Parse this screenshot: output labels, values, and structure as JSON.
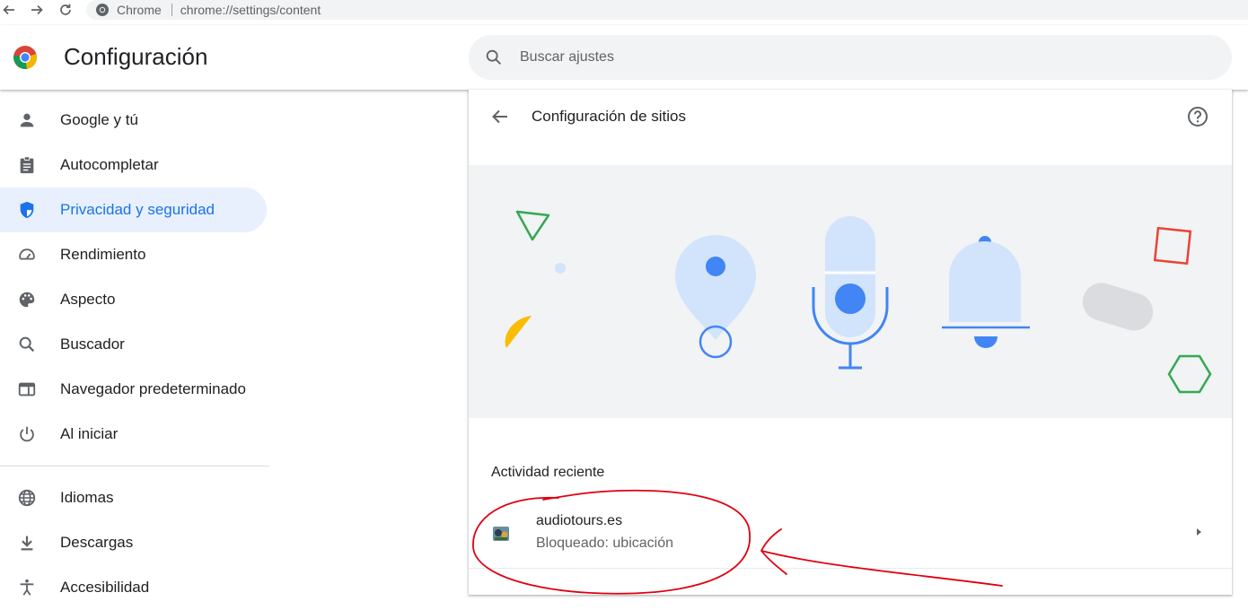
{
  "browser": {
    "back_icon": "arrow-back-icon",
    "forward_icon": "arrow-forward-icon",
    "reload_icon": "reload-icon",
    "site_label": "Chrome",
    "url": "chrome://settings/content"
  },
  "header": {
    "title": "Configuración",
    "search_placeholder": "Buscar ajustes"
  },
  "sidebar": {
    "items": [
      {
        "label": "Google y tú",
        "icon": "person-icon"
      },
      {
        "label": "Autocompletar",
        "icon": "clipboard-icon"
      },
      {
        "label": "Privacidad y seguridad",
        "icon": "shield-icon",
        "active": true
      },
      {
        "label": "Rendimiento",
        "icon": "speedometer-icon"
      },
      {
        "label": "Aspecto",
        "icon": "palette-icon"
      },
      {
        "label": "Buscador",
        "icon": "search-icon"
      },
      {
        "label": "Navegador predeterminado",
        "icon": "browser-window-icon"
      },
      {
        "label": "Al iniciar",
        "icon": "power-icon"
      }
    ],
    "items2": [
      {
        "label": "Idiomas",
        "icon": "globe-icon"
      },
      {
        "label": "Descargas",
        "icon": "download-icon"
      },
      {
        "label": "Accesibilidad",
        "icon": "accessibility-icon"
      }
    ]
  },
  "main": {
    "title": "Configuración de sitios",
    "section_title": "Actividad reciente",
    "recent": [
      {
        "site": "audiotours.es",
        "status": "Bloqueado: ubicación"
      }
    ]
  },
  "colors": {
    "accent": "#1a73e8",
    "active_bg": "#e8f0fe",
    "hero_bg": "#f1f3f4",
    "annotation": "#e0000f"
  }
}
